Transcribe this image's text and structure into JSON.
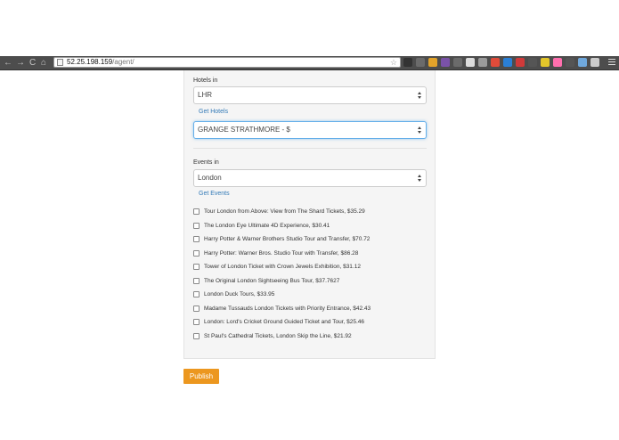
{
  "browser": {
    "url_host": "52.25.198.159",
    "url_path": "/agent/",
    "nav_back": "←",
    "nav_forward": "→",
    "nav_reload": "C",
    "nav_home": "⌂",
    "star": "☆",
    "extension_colors": [
      "#333333",
      "#6b6b6b",
      "#e2a32a",
      "#7a52a8",
      "#6b6b6b",
      "#dddddd",
      "#9b9b9b",
      "#e04b3a",
      "#2a7fd6",
      "#d13a3a",
      "#555555",
      "#e2c52a",
      "#ff6fae",
      "#555555",
      "#6fa8dc",
      "#cccccc"
    ]
  },
  "hotels": {
    "label": "Hotels in",
    "location": "LHR",
    "get_link": "Get Hotels",
    "selected_hotel": "GRANGE STRATHMORE - $"
  },
  "events": {
    "label": "Events in",
    "location": "London",
    "get_link": "Get Events",
    "items": [
      "Tour London from Above: View from The Shard Tickets, $35.29",
      "The London Eye Ultimate 4D Experience, $30.41",
      "Harry Potter & Warner Brothers Studio Tour and Transfer, $70.72",
      "Harry Potter: Warner Bros. Studio Tour with Transfer, $86.28",
      "Tower of London Ticket with Crown Jewels Exhibition, $31.12",
      "The Original London Sightseeing Bus Tour, $37.7627",
      "London Duck Tours, $33.95",
      "Madame Tussauds London Tickets with Priority Entrance, $42.43",
      "London: Lord's Cricket Ground Guided Ticket and Tour, $25.46",
      "St Paul's Cathedral Tickets, London Skip the Line, $21.92"
    ]
  },
  "publish_label": "Publish",
  "colors": {
    "accent": "#ec971f",
    "link": "#337ab7",
    "focus": "#66afe9"
  }
}
